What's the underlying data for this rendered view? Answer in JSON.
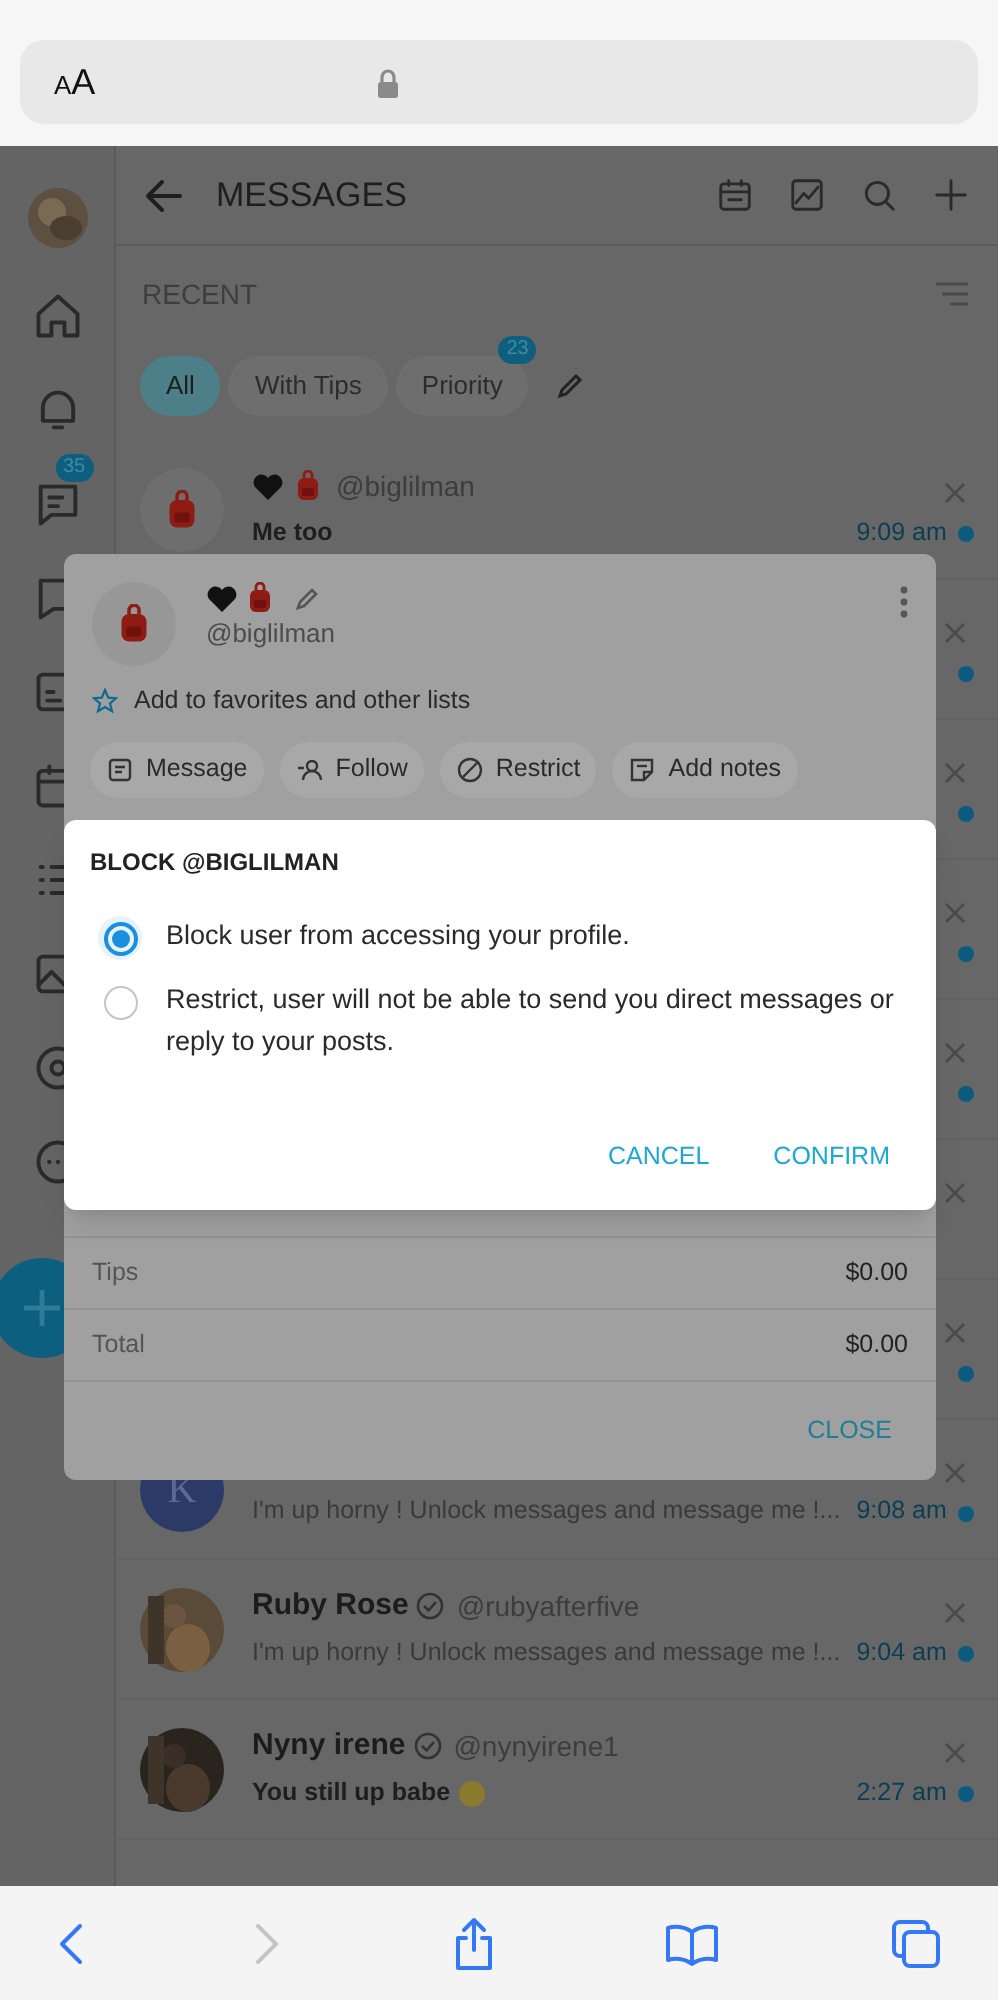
{
  "browser": {
    "text_size_button": "AA"
  },
  "header": {
    "title": "MESSAGES"
  },
  "sidebar": {
    "messages_badge": "35"
  },
  "section": {
    "title": "RECENT"
  },
  "filters": [
    {
      "label": "All",
      "selected": true
    },
    {
      "label": "With Tips",
      "selected": false
    },
    {
      "label": "Priority",
      "selected": false,
      "badge": "23"
    }
  ],
  "conversations": [
    {
      "kind": "emoji_name",
      "handle": "@biglilman",
      "message": "Me too",
      "time": "9:09 am",
      "unread": true
    },
    {
      "kind": "covered",
      "unread": true
    },
    {
      "kind": "covered",
      "unread": true
    },
    {
      "kind": "covered",
      "unread": true
    },
    {
      "kind": "covered",
      "unread": true
    },
    {
      "kind": "covered",
      "unread": false
    },
    {
      "kind": "covered",
      "unread": true
    },
    {
      "kind": "letter",
      "initial": "K",
      "message": "I'm up horny ! Unlock messages and message me !...",
      "time": "9:08 am",
      "unread": true
    },
    {
      "kind": "full",
      "name": "Ruby Rose",
      "verified": true,
      "handle": "@rubyafterfive",
      "message": "I'm up horny ! Unlock messages and message me !...",
      "time": "9:04 am",
      "unread": true,
      "bold": false
    },
    {
      "kind": "full",
      "name": "Nyny irene",
      "verified": true,
      "handle": "@nynyirene1",
      "message": "You still up babe",
      "emoji": true,
      "time": "2:27 am",
      "unread": true,
      "bold": true
    }
  ],
  "profile_card": {
    "handle": "@biglilman",
    "favorites": "Add to favorites and other lists",
    "actions": [
      {
        "kind": "message",
        "label": "Message"
      },
      {
        "kind": "follow",
        "label": "Follow"
      },
      {
        "kind": "restrict",
        "label": "Restrict"
      },
      {
        "kind": "notes",
        "label": "Add notes"
      }
    ],
    "totals": [
      {
        "label": "Tips",
        "value": "$0.00"
      },
      {
        "label": "Total",
        "value": "$0.00"
      }
    ],
    "close": "CLOSE"
  },
  "block_dialog": {
    "title": "BLOCK @BIGLILMAN",
    "options": [
      {
        "label": "Block user from accessing your profile.",
        "selected": true
      },
      {
        "label": "Restrict, user will not be able to send you direct messages or reply to your posts.",
        "selected": false
      }
    ],
    "buttons": [
      "CANCEL",
      "CONFIRM"
    ]
  }
}
